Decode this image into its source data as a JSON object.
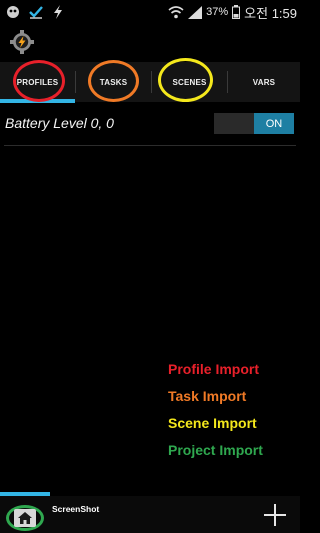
{
  "status_bar": {
    "battery_percent": "37%",
    "time": "오전 1:59",
    "icons": [
      "android-alien-icon",
      "check-icon",
      "lightning-icon",
      "wifi-icon",
      "signal-icon",
      "battery-icon"
    ]
  },
  "app": {
    "icon": "gear-lightning-icon"
  },
  "tabs": [
    {
      "label": "PROFILES",
      "selected": true,
      "ring_color": "#e8202a"
    },
    {
      "label": "TASKS",
      "selected": false,
      "ring_color": "#f07a26"
    },
    {
      "label": "SCENES",
      "selected": false,
      "ring_color": "#f4e81c"
    },
    {
      "label": "VARS",
      "selected": false
    }
  ],
  "profiles": [
    {
      "name": "Battery Level 0, 0",
      "toggle": "ON",
      "enabled": true
    }
  ],
  "legend": [
    {
      "text": "Profile Import",
      "color": "#e8202a"
    },
    {
      "text": "Task Import",
      "color": "#f07a26"
    },
    {
      "text": "Scene Import",
      "color": "#f4e81c"
    },
    {
      "text": "Project Import",
      "color": "#2fa84f"
    }
  ],
  "bottom_bar": {
    "project_label": "ScreenShot",
    "home_icon": "home-icon",
    "add_icon": "plus-icon",
    "home_ring_color": "#2fa84f"
  },
  "colors": {
    "accent": "#33b5e5",
    "toggle_on": "#1e7fa3"
  }
}
